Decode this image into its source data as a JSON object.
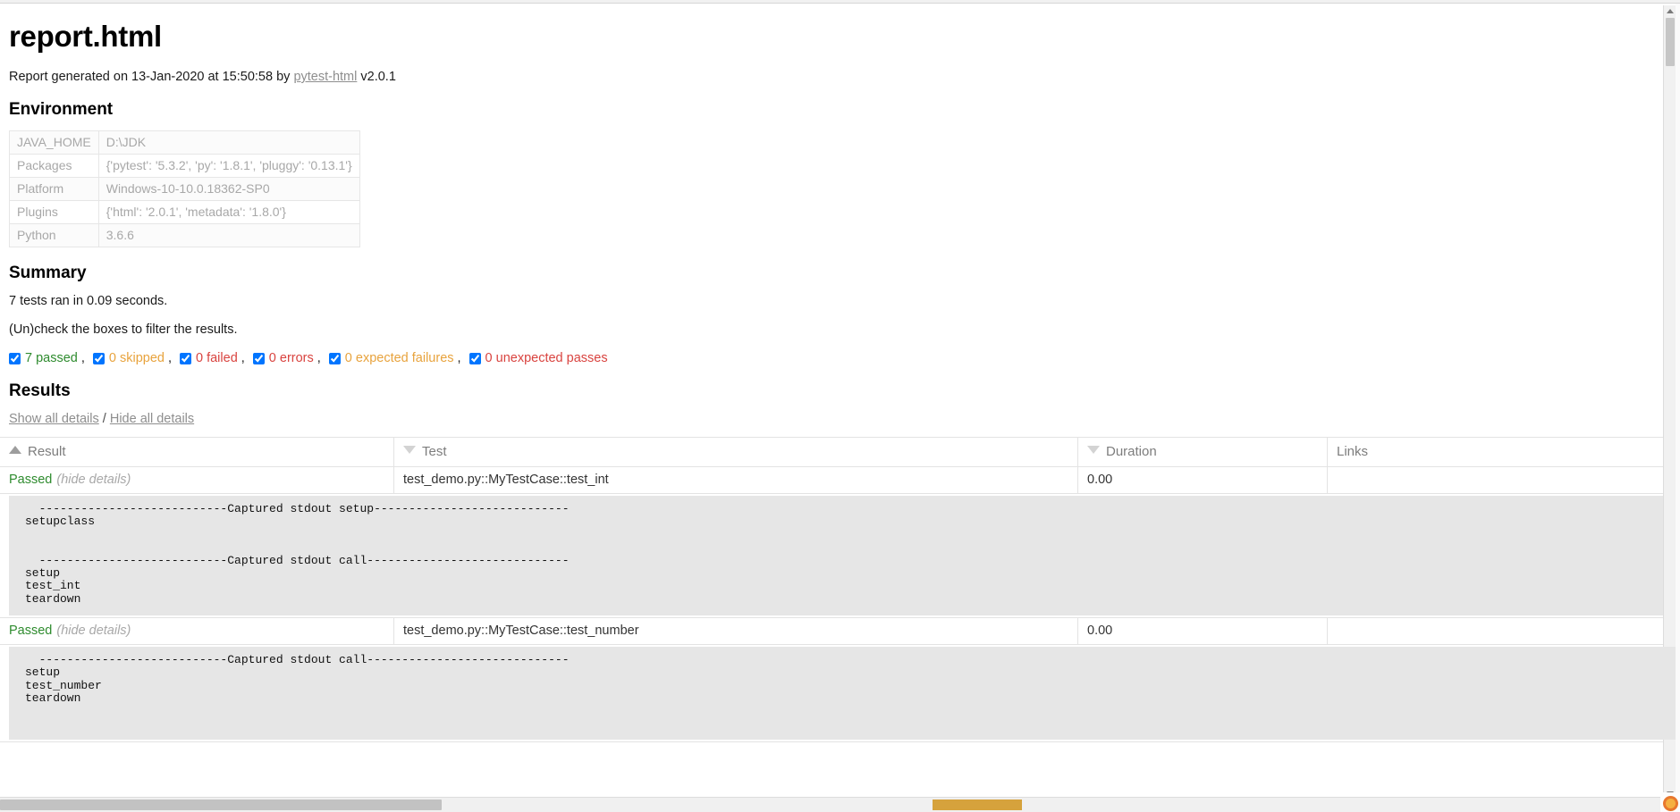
{
  "page": {
    "title": "report.html",
    "generated_prefix": "Report generated on 13-Jan-2020 at 15:50:58 by ",
    "generator_link": "pytest-html",
    "generator_version": " v2.0.1"
  },
  "environment": {
    "heading": "Environment",
    "rows": [
      {
        "key": "JAVA_HOME",
        "value": "D:\\JDK"
      },
      {
        "key": "Packages",
        "value": "{'pytest': '5.3.2', 'py': '1.8.1', 'pluggy': '0.13.1'}"
      },
      {
        "key": "Platform",
        "value": "Windows-10-10.0.18362-SP0"
      },
      {
        "key": "Plugins",
        "value": "{'html': '2.0.1', 'metadata': '1.8.0'}"
      },
      {
        "key": "Python",
        "value": "3.6.6"
      }
    ]
  },
  "summary": {
    "heading": "Summary",
    "run_line": "7 tests ran in 0.09 seconds.",
    "filter_hint": "(Un)check the boxes to filter the results.",
    "filters": [
      {
        "label": "7 passed",
        "color": "#2e8b2e",
        "checked": true,
        "separator": ","
      },
      {
        "label": "0 skipped",
        "color": "#e8a33d",
        "checked": true,
        "separator": ","
      },
      {
        "label": "0 failed",
        "color": "#d9433f",
        "checked": true,
        "separator": ","
      },
      {
        "label": "0 errors",
        "color": "#d9433f",
        "checked": true,
        "separator": ","
      },
      {
        "label": "0 expected failures",
        "color": "#e8a33d",
        "checked": true,
        "separator": ","
      },
      {
        "label": "0 unexpected passes",
        "color": "#d9433f",
        "checked": true,
        "separator": ""
      }
    ]
  },
  "results": {
    "heading": "Results",
    "show_all": "Show all details",
    "separator": "/",
    "hide_all": "Hide all details",
    "columns": [
      {
        "label": "Result",
        "sort": "asc"
      },
      {
        "label": "Test",
        "sort": "desc"
      },
      {
        "label": "Duration",
        "sort": "desc"
      },
      {
        "label": "Links",
        "sort": "none"
      }
    ],
    "rows": [
      {
        "result": "Passed",
        "toggle": "(hide details)",
        "test": "test_demo.py::MyTestCase::test_int",
        "duration": "0.00",
        "links": "",
        "log": "  ---------------------------Captured stdout setup----------------------------\nsetupclass\n\n\n  ---------------------------Captured stdout call-----------------------------\nsetup\ntest_int\nteardown"
      },
      {
        "result": "Passed",
        "toggle": "(hide details)",
        "test": "test_demo.py::MyTestCase::test_number",
        "duration": "0.00",
        "links": "",
        "log": "  ---------------------------Captured stdout call-----------------------------\nsetup\ntest_number\nteardown"
      }
    ]
  }
}
